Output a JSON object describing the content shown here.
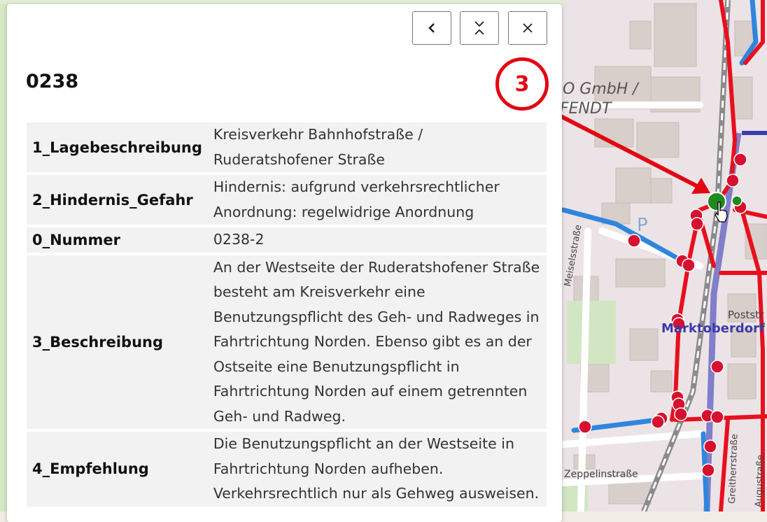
{
  "popup": {
    "title": "0238",
    "buttons": {
      "back": {
        "icon": "chevron-left-icon"
      },
      "collapse": {
        "icon": "collapse-icon"
      },
      "close": {
        "icon": "close-icon"
      }
    },
    "rows": [
      {
        "key": "1_Lagebeschreibung",
        "lines": [
          "Kreisverkehr Bahnhofstraße /",
          "Ruderatshofener Straße"
        ]
      },
      {
        "key": "2_Hindernis_Gefahr",
        "lines": [
          "Hindernis: aufgrund verkehrsrechtlicher",
          "Anordnung: regelwidrige Anordnung"
        ]
      },
      {
        "key": "0_Nummer",
        "lines": [
          "0238-2"
        ]
      },
      {
        "key": "3_Beschreibung",
        "lines": [
          "An der Westseite der Ruderatshofener Straße",
          "besteht am Kreisverkehr eine",
          "Benutzungspflicht des Geh- und Radweges in",
          "Fahrtrichtung Norden. Ebenso gibt es an der",
          "Ostseite eine Benutzungspflicht in",
          "Fahrtrichtung Norden auf einem getrennten",
          "Geh- und Radweg."
        ]
      },
      {
        "key": "4_Empfehlung",
        "lines": [
          "Die Benutzungspflicht an der Westseite in",
          "Fahrtrichtung Norden aufheben.",
          "Verkehrsrechtlich nur als Gehweg ausweisen."
        ]
      }
    ]
  },
  "callout": {
    "number": "3",
    "color": "#e30613"
  },
  "map": {
    "labels": {
      "company_1": "O GmbH /",
      "company_2": "FENDT",
      "parking": "P",
      "town": "Marktoberdorf",
      "post": "Poststr",
      "street_zeppelin": "Zeppelinstraße",
      "street_greith": "Greitherrstraße",
      "street_west": "Meiselsstraße",
      "street_right": "Augustraße"
    },
    "colors": {
      "route": "#e8101e",
      "cycle": "#2e86de",
      "rail": "#7a78c8",
      "marker": "#d6112f",
      "selected": "#1f8a1f"
    }
  }
}
